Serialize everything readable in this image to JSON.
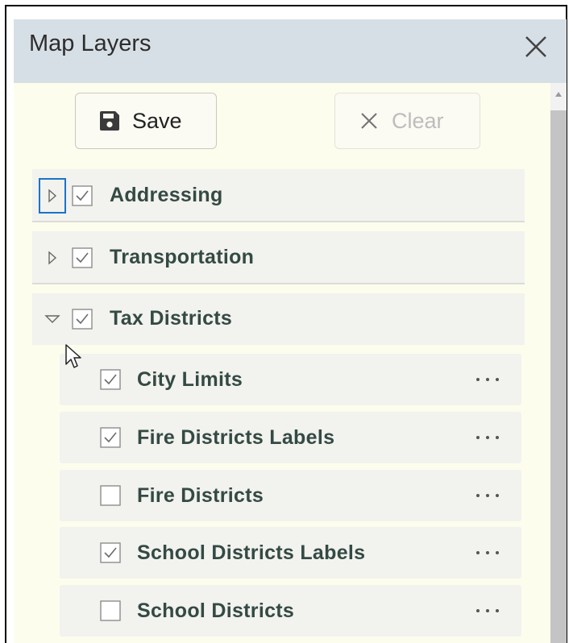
{
  "panel": {
    "title": "Map Layers",
    "close_icon": "close-icon"
  },
  "toolbar": {
    "save_label": "Save",
    "save_icon": "floppy-disk-icon",
    "clear_label": "Clear",
    "clear_icon": "x-icon",
    "clear_disabled": true
  },
  "groups": [
    {
      "label": "Addressing",
      "checked": true,
      "expanded": false,
      "focused": true
    },
    {
      "label": "Transportation",
      "checked": true,
      "expanded": false,
      "focused": false
    },
    {
      "label": "Tax Districts",
      "checked": true,
      "expanded": true,
      "focused": false,
      "layers": [
        {
          "label": "City Limits",
          "checked": true
        },
        {
          "label": "Fire Districts Labels",
          "checked": true
        },
        {
          "label": "Fire Districts",
          "checked": false
        },
        {
          "label": "School Districts Labels",
          "checked": true
        },
        {
          "label": "School Districts",
          "checked": false
        }
      ]
    }
  ],
  "colors": {
    "header_bg": "#d7dfe6",
    "panel_bg": "#fdfdee",
    "row_bg": "#f2f2ee",
    "label_text": "#344a44",
    "focus_outline": "#1a73c8"
  }
}
